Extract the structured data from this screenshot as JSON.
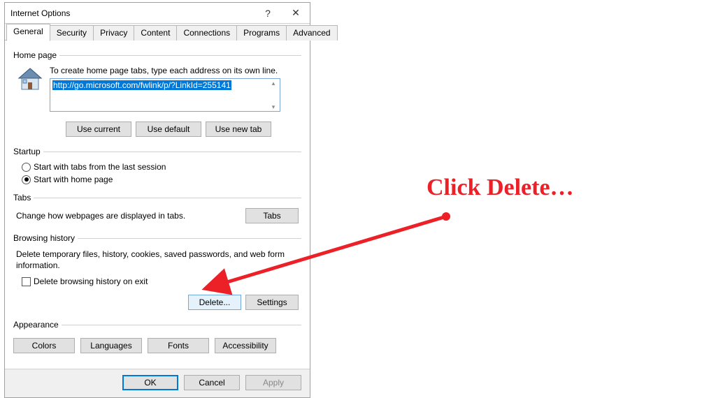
{
  "window": {
    "title": "Internet Options",
    "help_label": "?",
    "close_label": "✕"
  },
  "tabs": [
    {
      "label": "General"
    },
    {
      "label": "Security"
    },
    {
      "label": "Privacy"
    },
    {
      "label": "Content"
    },
    {
      "label": "Connections"
    },
    {
      "label": "Programs"
    },
    {
      "label": "Advanced"
    }
  ],
  "homepage": {
    "legend": "Home page",
    "hint": "To create home page tabs, type each address on its own line.",
    "url": "http://go.microsoft.com/fwlink/p/?LinkId=255141",
    "use_current": "Use current",
    "use_default": "Use default",
    "use_new_tab": "Use new tab"
  },
  "startup": {
    "legend": "Startup",
    "opt1": "Start with tabs from the last session",
    "opt2": "Start with home page"
  },
  "tabs_section": {
    "legend": "Tabs",
    "desc": "Change how webpages are displayed in tabs.",
    "button": "Tabs"
  },
  "browsing_history": {
    "legend": "Browsing history",
    "desc": "Delete temporary files, history, cookies, saved passwords, and web form information.",
    "checkbox_label": "Delete browsing history on exit",
    "delete_btn": "Delete...",
    "settings_btn": "Settings"
  },
  "appearance": {
    "legend": "Appearance",
    "colors": "Colors",
    "languages": "Languages",
    "fonts": "Fonts",
    "accessibility": "Accessibility"
  },
  "footer": {
    "ok": "OK",
    "cancel": "Cancel",
    "apply": "Apply"
  },
  "annotation": {
    "text": "Click Delete…",
    "color": "#ec2027"
  }
}
